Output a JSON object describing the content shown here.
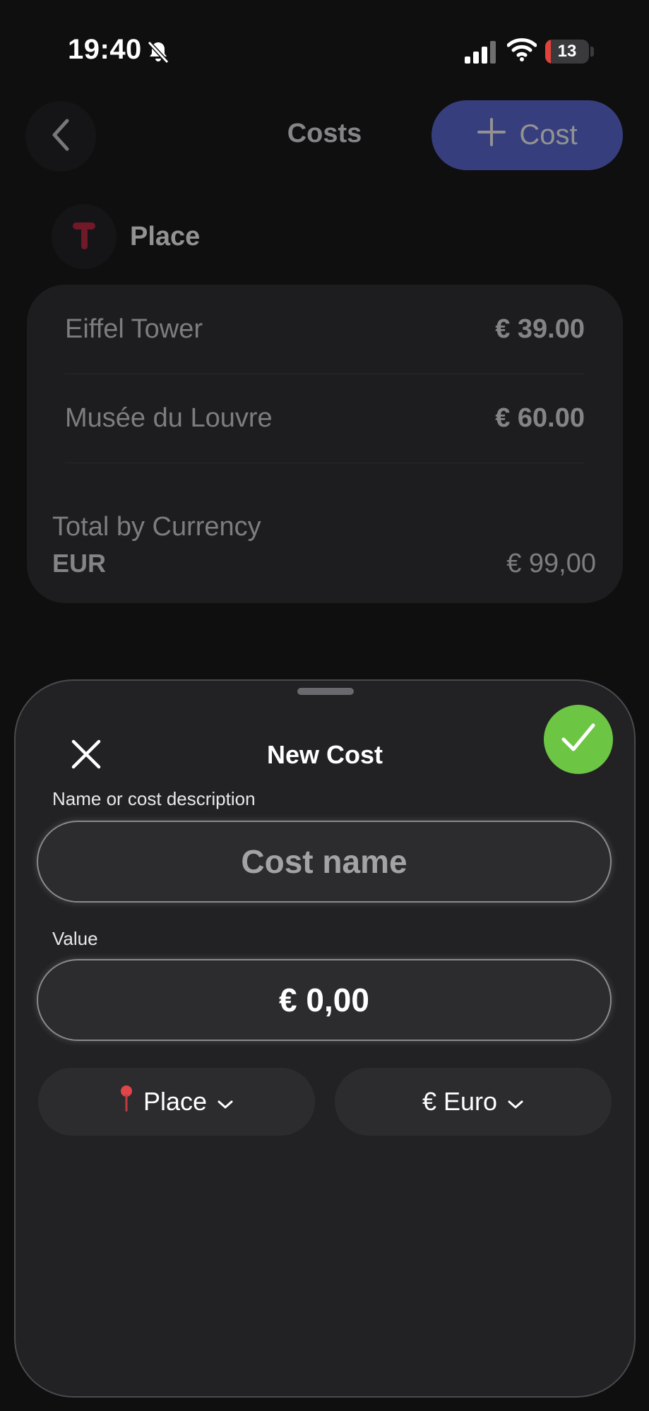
{
  "status_bar": {
    "time": "19:40",
    "battery": "13",
    "battery_level": 0.13
  },
  "header": {
    "title": "Costs",
    "add_button_label": "Cost"
  },
  "category": {
    "label": "Place",
    "icon": "pin-icon",
    "icon_color": "#c0233f"
  },
  "costs": [
    {
      "name": "Eiffel Tower",
      "amount": "€ 39.00"
    },
    {
      "name": "Musée du Louvre",
      "amount": "€ 60.00"
    }
  ],
  "totals": {
    "label": "Total by Currency",
    "currency": "EUR",
    "amount": "€ 99,00"
  },
  "sheet": {
    "title": "New Cost",
    "name_label": "Name or cost description",
    "name_placeholder": "Cost name",
    "name_value": "",
    "value_label": "Value",
    "value": "€ 0,00",
    "category_picker": "Place",
    "currency_picker": "€ Euro"
  },
  "colors": {
    "accent": "#5866d8",
    "confirm": "#6cc644",
    "background": "#0f0f10",
    "sheet": "#222224"
  }
}
